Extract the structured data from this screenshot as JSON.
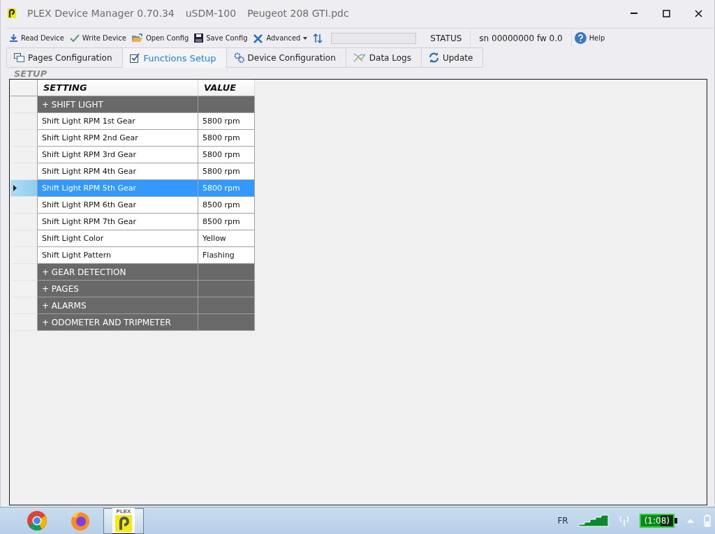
{
  "window": {
    "title_parts": [
      "PLEX Device Manager 0.70.34",
      "uSDM-100",
      "Peugeot 208 GTI.pdc"
    ]
  },
  "toolbar": [
    {
      "kind": "button",
      "label": "Read Device"
    },
    {
      "kind": "button",
      "label": "Write Device"
    },
    {
      "kind": "button",
      "label": "Open Config"
    },
    {
      "kind": "button",
      "label": "Save Config"
    },
    {
      "kind": "dropdown",
      "label": "Advanced"
    },
    {
      "kind": "icon"
    },
    {
      "kind": "progress",
      "level": 0
    },
    {
      "kind": "label",
      "label": "STATUS"
    },
    {
      "kind": "label",
      "label": "sn 00000000 fw 0.0"
    },
    {
      "kind": "button",
      "label": "Help"
    }
  ],
  "tabs": [
    {
      "label": "Pages Configuration",
      "selected": false
    },
    {
      "label": "Functions Setup",
      "selected": true
    },
    {
      "label": "Device Configuration",
      "selected": false
    },
    {
      "label": "Data Logs",
      "selected": false
    },
    {
      "label": "Update",
      "selected": false
    }
  ],
  "section": {
    "title": "SETUP"
  },
  "table": {
    "columns": [
      "SETTING",
      "VALUE"
    ],
    "rows": [
      {
        "kind": "group",
        "label": "+ SHIFT LIGHT"
      },
      {
        "kind": "setting",
        "setting": "Shift Light RPM 1st Gear",
        "value": "5800 rpm",
        "selected": false
      },
      {
        "kind": "setting",
        "setting": "Shift Light RPM 2nd Gear",
        "value": "5800 rpm",
        "selected": false
      },
      {
        "kind": "setting",
        "setting": "Shift Light RPM 3rd Gear",
        "value": "5800 rpm",
        "selected": false
      },
      {
        "kind": "setting",
        "setting": "Shift Light RPM 4th Gear",
        "value": "5800 rpm",
        "selected": false
      },
      {
        "kind": "setting",
        "setting": "Shift Light RPM 5th Gear",
        "value": "5800 rpm",
        "selected": true
      },
      {
        "kind": "setting",
        "setting": "Shift Light RPM 6th Gear",
        "value": "8500 rpm",
        "selected": false
      },
      {
        "kind": "setting",
        "setting": "Shift Light RPM 7th Gear",
        "value": "8500 rpm",
        "selected": false
      },
      {
        "kind": "setting",
        "setting": "Shift Light Color",
        "value": "Yellow",
        "selected": false
      },
      {
        "kind": "setting",
        "setting": "Shift Light Pattern",
        "value": "Flashing",
        "selected": false
      },
      {
        "kind": "group",
        "label": "+ GEAR DETECTION"
      },
      {
        "kind": "group",
        "label": "+ PAGES"
      },
      {
        "kind": "group",
        "label": "+ ALARMS"
      },
      {
        "kind": "group",
        "label": "+ ODOMETER AND TRIPMETER"
      }
    ]
  },
  "taskbar": {
    "apps": [
      {
        "kind": "chrome",
        "selected": false
      },
      {
        "kind": "firefox",
        "selected": false
      },
      {
        "kind": "plex",
        "label": "PLEX",
        "selected": true
      }
    ],
    "tray": {
      "language": "FR",
      "battery_time": "(1:08)"
    }
  }
}
